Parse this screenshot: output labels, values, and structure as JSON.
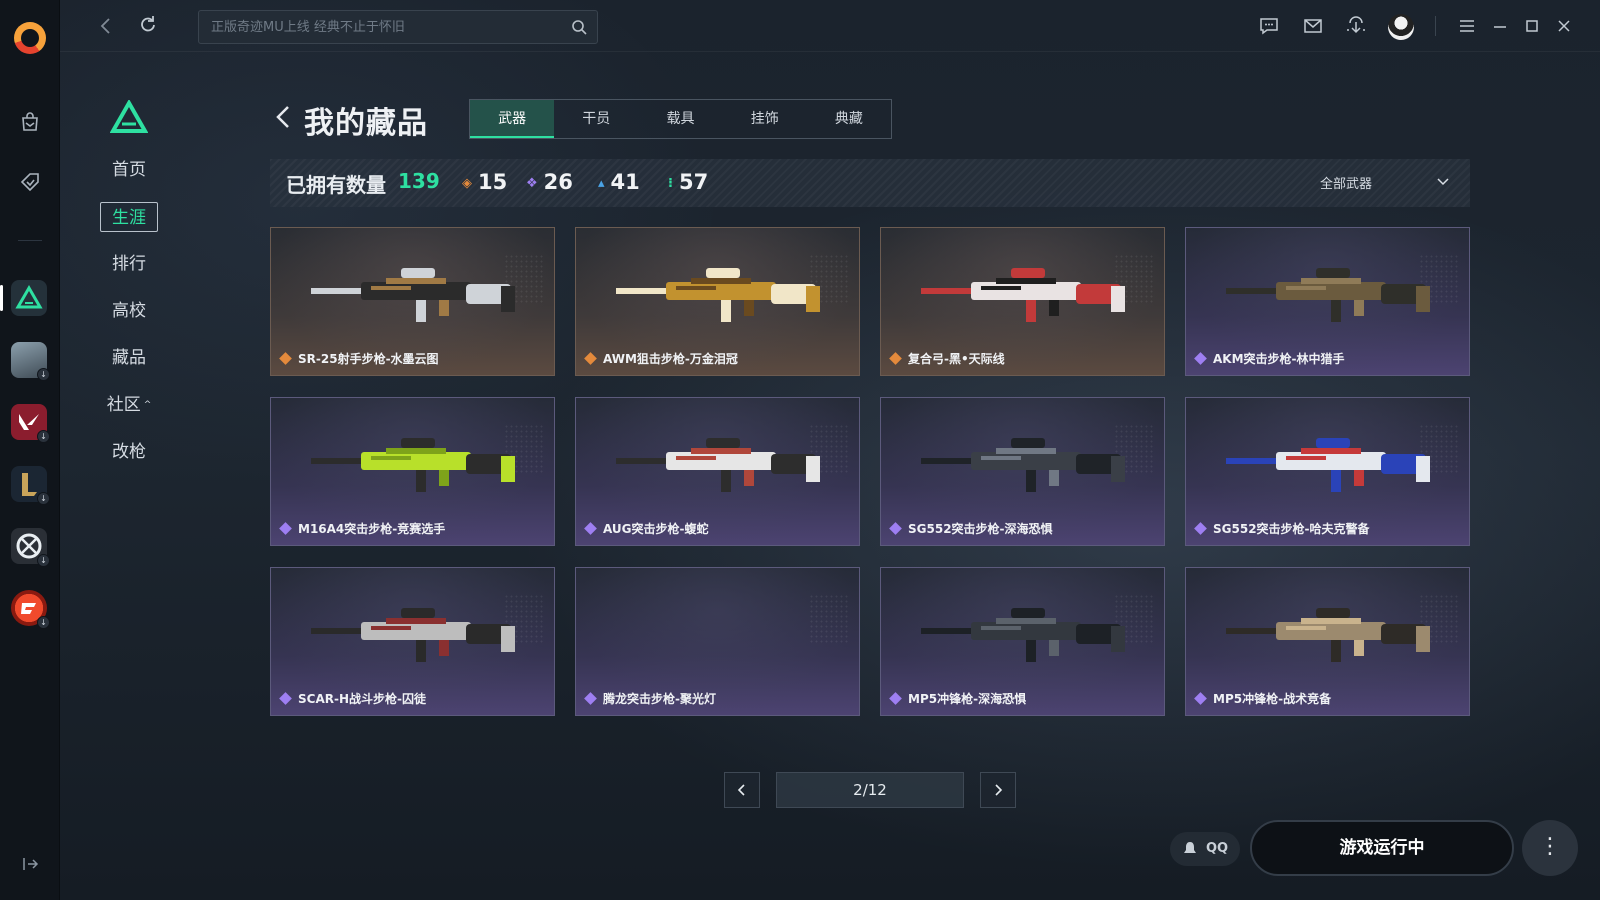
{
  "search": {
    "placeholder": "正版奇迹MU上线 经典不止于怀旧"
  },
  "icons": {
    "app_logo": "swirl-logo-icon",
    "rail": [
      "bag-icon",
      "tag-icon",
      "game-triangle-icon",
      "game-helmet-icon",
      "game-valorant-icon",
      "game-lol-icon",
      "game-csgo-icon",
      "game-cf-icon"
    ],
    "topbar": [
      "chat-icon",
      "mail-icon",
      "download-icon",
      "avatar",
      "menu-icon",
      "minimize-icon",
      "maximize-icon",
      "close-icon"
    ]
  },
  "secnav": {
    "items": [
      {
        "label": "首页",
        "active": false
      },
      {
        "label": "生涯",
        "active": true
      },
      {
        "label": "排行",
        "active": false
      },
      {
        "label": "高校",
        "active": false
      },
      {
        "label": "藏品",
        "active": false
      },
      {
        "label": "社区",
        "active": false,
        "caret": "^"
      },
      {
        "label": "改枪",
        "active": false
      }
    ]
  },
  "header": {
    "title": "我的藏品",
    "tabs": [
      {
        "label": "武器",
        "active": true
      },
      {
        "label": "干员",
        "active": false
      },
      {
        "label": "载具",
        "active": false
      },
      {
        "label": "挂饰",
        "active": false
      },
      {
        "label": "典藏",
        "active": false
      }
    ]
  },
  "stats": {
    "owned_label": "已拥有数量",
    "owned_total": "139",
    "rarities": [
      {
        "glyph": "◈",
        "color": "#e48a3c",
        "count": "15"
      },
      {
        "glyph": "❖",
        "color": "#9e7ff2",
        "count": "26"
      },
      {
        "glyph": "▴",
        "color": "#4aa3e6",
        "count": "41"
      },
      {
        "glyph": "⁝",
        "color": "#2ee0a1",
        "count": "57"
      }
    ],
    "filter_label": "全部武器"
  },
  "cards": [
    {
      "name": "SR-25射手步枪-水墨云图",
      "rarity": "orange",
      "palette": [
        "#2b2b2b",
        "#cfd3d8",
        "#a07a45"
      ]
    },
    {
      "name": "AWM狙击步枪-万金泪冠",
      "rarity": "orange",
      "palette": [
        "#c2922f",
        "#f1e6c8",
        "#6a4a1f"
      ]
    },
    {
      "name": "复合弓-黑•天际线",
      "rarity": "orange",
      "palette": [
        "#e9e3e3",
        "#c23a3a",
        "#1f1f1f"
      ]
    },
    {
      "name": "AKM突击步枪-林中猎手",
      "rarity": "purple",
      "palette": [
        "#6b5b3e",
        "#2f2f2a",
        "#8f7b58"
      ]
    },
    {
      "name": "M16A4突击步枪-竞赛选手",
      "rarity": "purple",
      "palette": [
        "#b8e02a",
        "#2c2c2c",
        "#7ea31a"
      ]
    },
    {
      "name": "AUG突击步枪-蝮蛇",
      "rarity": "purple",
      "palette": [
        "#e6e6e6",
        "#2d2d2d",
        "#b0473b"
      ]
    },
    {
      "name": "SG552突击步枪-深海恐惧",
      "rarity": "purple",
      "palette": [
        "#3a3f47",
        "#1f2328",
        "#707884"
      ]
    },
    {
      "name": "SG552突击步枪-哈夫克警备",
      "rarity": "purple",
      "palette": [
        "#e4e8ee",
        "#2a43b8",
        "#c53a3a"
      ]
    },
    {
      "name": "SCAR-H战斗步枪-囚徒",
      "rarity": "purple",
      "palette": [
        "#bdbdbd",
        "#2a2a2a",
        "#8a3030"
      ]
    },
    {
      "name": "腾龙突击步枪-聚光灯",
      "rarity": "purple",
      "palette": []
    },
    {
      "name": "MP5冲锋枪-深海恐惧",
      "rarity": "purple",
      "palette": [
        "#33383f",
        "#1d2126",
        "#5b626b"
      ]
    },
    {
      "name": "MP5冲锋枪-战术竞备",
      "rarity": "purple",
      "palette": [
        "#9c8a6e",
        "#2e2b27",
        "#c9b38d"
      ]
    }
  ],
  "pagination": {
    "current": "2/12"
  },
  "bottom": {
    "qq_label": "QQ",
    "status_button": "游戏运行中",
    "more": "⋮"
  },
  "colors": {
    "accent": "#2ee0a1",
    "orange_rarity": "#e48a3c",
    "purple_rarity": "#9e7ff2"
  }
}
